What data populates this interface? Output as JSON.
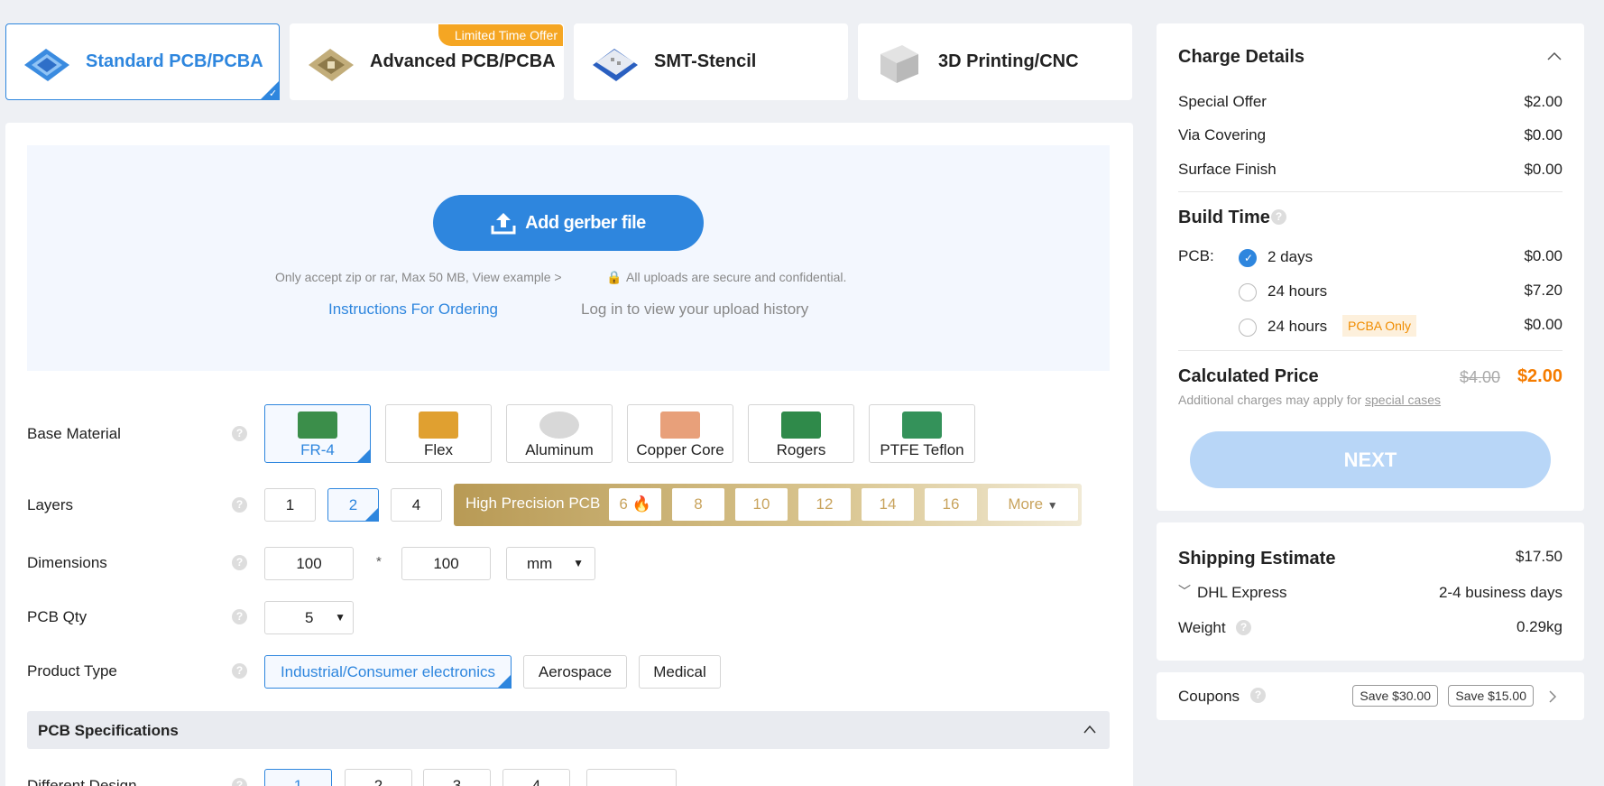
{
  "tabs": [
    {
      "label": "Standard PCB/PCBA"
    },
    {
      "label": "Advanced PCB/PCBA",
      "badge": "Limited Time Offer"
    },
    {
      "label": "SMT-Stencil"
    },
    {
      "label": "3D Printing/CNC"
    }
  ],
  "upload": {
    "button": "Add gerber file",
    "hint": "Only accept zip or rar, Max 50 MB, View example >",
    "secure": "All uploads are secure and confidential.",
    "instructions": "Instructions For Ordering",
    "history": "Log in to view your upload history"
  },
  "form": {
    "base_material": {
      "label": "Base Material",
      "options": [
        "FR-4",
        "Flex",
        "Aluminum",
        "Copper Core",
        "Rogers",
        "PTFE Teflon"
      ],
      "selected": "FR-4"
    },
    "layers": {
      "label": "Layers",
      "options": [
        "1",
        "2",
        "4"
      ],
      "selected": "2",
      "high_precision_label": "High Precision PCB",
      "high_precision_options": [
        "6",
        "8",
        "10",
        "12",
        "14",
        "16"
      ],
      "more": "More"
    },
    "dimensions": {
      "label": "Dimensions",
      "x": "100",
      "sep": "*",
      "y": "100",
      "unit": "mm"
    },
    "qty": {
      "label": "PCB Qty",
      "value": "5"
    },
    "product_type": {
      "label": "Product Type",
      "options": [
        "Industrial/Consumer electronics",
        "Aerospace",
        "Medical"
      ],
      "selected": "Industrial/Consumer electronics"
    },
    "spec_header": "PCB Specifications",
    "different_design": {
      "label": "Different Design",
      "options": [
        "1",
        "2",
        "3",
        "4"
      ]
    }
  },
  "charge": {
    "title": "Charge Details",
    "items": [
      {
        "label": "Special Offer",
        "value": "$2.00"
      },
      {
        "label": "Via Covering",
        "value": "$0.00"
      },
      {
        "label": "Surface Finish",
        "value": "$0.00"
      }
    ],
    "build_time_title": "Build Time",
    "pcb_label": "PCB:",
    "build_options": [
      {
        "label": "2 days",
        "value": "$0.00",
        "checked": true
      },
      {
        "label": "24 hours",
        "value": "$7.20",
        "checked": false
      },
      {
        "label": "24 hours",
        "value": "$0.00",
        "checked": false,
        "tag": "PCBA Only"
      }
    ],
    "calc_title": "Calculated Price",
    "old_price": "$4.00",
    "price": "$2.00",
    "note_prefix": "Additional charges may apply for",
    "note_link": "special cases",
    "next": "NEXT"
  },
  "shipping": {
    "title": "Shipping Estimate",
    "price": "$17.50",
    "method": "DHL Express",
    "days": "2-4 business days",
    "weight_label": "Weight",
    "weight": "0.29kg"
  },
  "coupons": {
    "label": "Coupons",
    "items": [
      "Save $30.00",
      "Save $15.00"
    ]
  },
  "colors": {
    "accent": "#2e86de",
    "price": "#f57c00",
    "gold": "#c9a45e"
  }
}
